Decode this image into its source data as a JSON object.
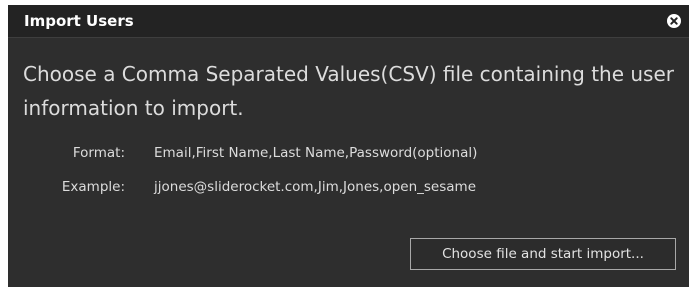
{
  "dialog": {
    "title": "Import Users",
    "close_icon": "close-icon",
    "prompt": "Choose a Comma Separated Values(CSV) file containing the user information to import.",
    "format": {
      "label": "Format:",
      "value": "Email,First Name,Last Name,Password(optional)"
    },
    "example": {
      "label": "Example:",
      "value": "jjones@sliderocket.com,Jim,Jones,open_sesame"
    },
    "import_button_label": "Choose file and start import..."
  },
  "colors": {
    "titlebar_bg": "#232323",
    "dialog_bg": "#2e2e2e",
    "text": "#dcdcdc",
    "button_border": "#a8a8a8"
  }
}
